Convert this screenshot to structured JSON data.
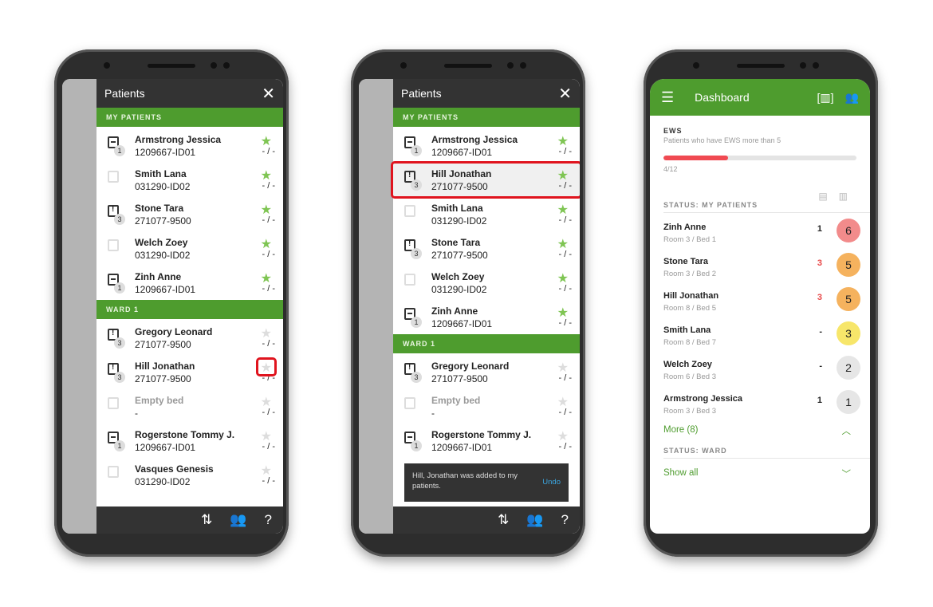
{
  "colors": {
    "accent": "#4e9c2e",
    "star": "#7fc553",
    "highlight": "#e0141e"
  },
  "phone1": {
    "title": "Patients",
    "close_icon": "close-icon",
    "sections": [
      {
        "label": "MY PATIENTS",
        "rows": [
          {
            "name": "Armstrong Jessica",
            "id": "1209667-ID01",
            "icon": "doc",
            "badge": "1",
            "starred": true,
            "value": "- / -"
          },
          {
            "name": "Smith Lana",
            "id": "031290-ID02",
            "icon": "empty",
            "badge": "",
            "starred": true,
            "value": "- / -"
          },
          {
            "name": "Stone Tara",
            "id": "271077-9500",
            "icon": "alert",
            "badge": "3",
            "starred": true,
            "value": "- / -"
          },
          {
            "name": "Welch Zoey",
            "id": "031290-ID02",
            "icon": "empty",
            "badge": "",
            "starred": true,
            "value": "- / -"
          },
          {
            "name": "Zinh Anne",
            "id": "1209667-ID01",
            "icon": "doc",
            "badge": "1",
            "starred": true,
            "value": "- / -"
          }
        ]
      },
      {
        "label": "WARD 1",
        "rows": [
          {
            "name": "Gregory Leonard",
            "id": "271077-9500",
            "icon": "alert",
            "badge": "3",
            "starred": false,
            "value": "- / -"
          },
          {
            "name": "Hill Jonathan",
            "id": "271077-9500",
            "icon": "alert",
            "badge": "3",
            "starred": false,
            "value": "- / -",
            "star_highlight": true
          },
          {
            "name": "Empty bed",
            "id": "-",
            "icon": "empty",
            "badge": "",
            "starred": false,
            "value": "- / -",
            "empty": true
          },
          {
            "name": "Rogerstone Tommy J.",
            "id": "1209667-ID01",
            "icon": "doc",
            "badge": "1",
            "starred": false,
            "value": "- / -"
          },
          {
            "name": "Vasques Genesis",
            "id": "031290-ID02",
            "icon": "empty",
            "badge": "",
            "starred": false,
            "value": "- / -"
          }
        ]
      }
    ],
    "bottom": [
      "sort",
      "group",
      "?"
    ]
  },
  "phone2": {
    "title": "Patients",
    "sections": [
      {
        "label": "MY PATIENTS",
        "rows": [
          {
            "name": "Armstrong Jessica",
            "id": "1209667-ID01",
            "icon": "doc",
            "badge": "1",
            "starred": true,
            "value": "- / -"
          },
          {
            "name": "Hill Jonathan",
            "id": "271077-9500",
            "icon": "alert",
            "badge": "3",
            "starred": true,
            "value": "- / -",
            "row_highlight": true
          },
          {
            "name": "Smith Lana",
            "id": "031290-ID02",
            "icon": "empty",
            "badge": "",
            "starred": true,
            "value": "- / -"
          },
          {
            "name": "Stone Tara",
            "id": "271077-9500",
            "icon": "alert",
            "badge": "3",
            "starred": true,
            "value": "- / -"
          },
          {
            "name": "Welch Zoey",
            "id": "031290-ID02",
            "icon": "empty",
            "badge": "",
            "starred": true,
            "value": "- / -"
          },
          {
            "name": "Zinh Anne",
            "id": "1209667-ID01",
            "icon": "doc",
            "badge": "1",
            "starred": true,
            "value": "- / -"
          }
        ]
      },
      {
        "label": "WARD 1",
        "rows": [
          {
            "name": "Gregory Leonard",
            "id": "271077-9500",
            "icon": "alert",
            "badge": "3",
            "starred": false,
            "value": "- / -"
          },
          {
            "name": "Empty bed",
            "id": "-",
            "icon": "empty",
            "badge": "",
            "starred": false,
            "value": "- / -",
            "empty": true
          },
          {
            "name": "Rogerstone Tommy J.",
            "id": "1209667-ID01",
            "icon": "doc",
            "badge": "1",
            "starred": false,
            "value": "- / -"
          }
        ]
      }
    ],
    "snackbar": {
      "message": "Hill, Jonathan was added to my patients.",
      "action": "Undo"
    }
  },
  "dashboard": {
    "title": "Dashboard",
    "ews": {
      "label": "EWS",
      "description": "Patients who have EWS more than 5",
      "progress_text": "4/12",
      "progress": 0.3333
    },
    "status_label": "STATUS: MY PATIENTS",
    "patients": [
      {
        "name": "Zinh Anne",
        "room": "Room 3 / Bed 1",
        "count": "1",
        "count_alert": false,
        "score": "6",
        "color": "#f28b8b"
      },
      {
        "name": "Stone Tara",
        "room": "Room 3 / Bed 2",
        "count": "3",
        "count_alert": true,
        "score": "5",
        "color": "#f5b25e"
      },
      {
        "name": "Hill Jonathan",
        "room": "Room 8 / Bed 5",
        "count": "3",
        "count_alert": true,
        "score": "5",
        "color": "#f5b25e"
      },
      {
        "name": "Smith Lana",
        "room": "Room 8 / Bed 7",
        "count": "-",
        "count_alert": false,
        "score": "3",
        "color": "#f7e66a"
      },
      {
        "name": "Welch Zoey",
        "room": "Room 6 / Bed 3",
        "count": "-",
        "count_alert": false,
        "score": "2",
        "color": "#e6e6e6"
      },
      {
        "name": "Armstrong Jessica",
        "room": "Room 3 / Bed 3",
        "count": "1",
        "count_alert": false,
        "score": "1",
        "color": "#e6e6e6"
      }
    ],
    "more": "More (8)",
    "ward_label": "STATUS: WARD",
    "show_all": "Show all"
  }
}
